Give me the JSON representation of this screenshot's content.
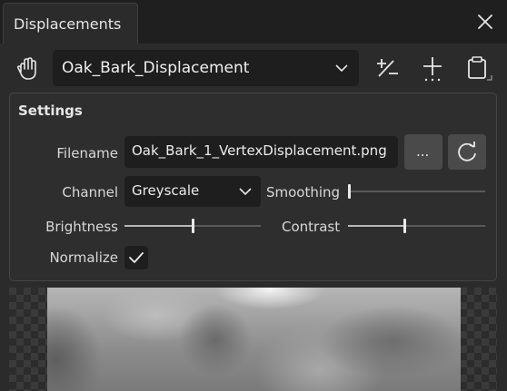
{
  "tab": {
    "title": "Displacements"
  },
  "toolbar": {
    "displacement_select": "Oak_Bark_Displacement",
    "icons": [
      "hand-icon",
      "add-subtract-icon",
      "add-point-icon",
      "clipboard-icon"
    ]
  },
  "settings": {
    "title": "Settings",
    "filename_label": "Filename",
    "filename_value": "Oak_Bark_1_VertexDisplacement.png",
    "browse_label": "...",
    "channel_label": "Channel",
    "channel_value": "Greyscale",
    "smoothing_label": "Smoothing",
    "smoothing_value": 0.0,
    "brightness_label": "Brightness",
    "brightness_value": 0.5,
    "contrast_label": "Contrast",
    "contrast_value": 0.41,
    "normalize_label": "Normalize",
    "normalize_checked": true
  },
  "colors": {
    "background": "#2b2b2b",
    "field": "#1e1e1e",
    "accent": "#e8e8e8"
  }
}
